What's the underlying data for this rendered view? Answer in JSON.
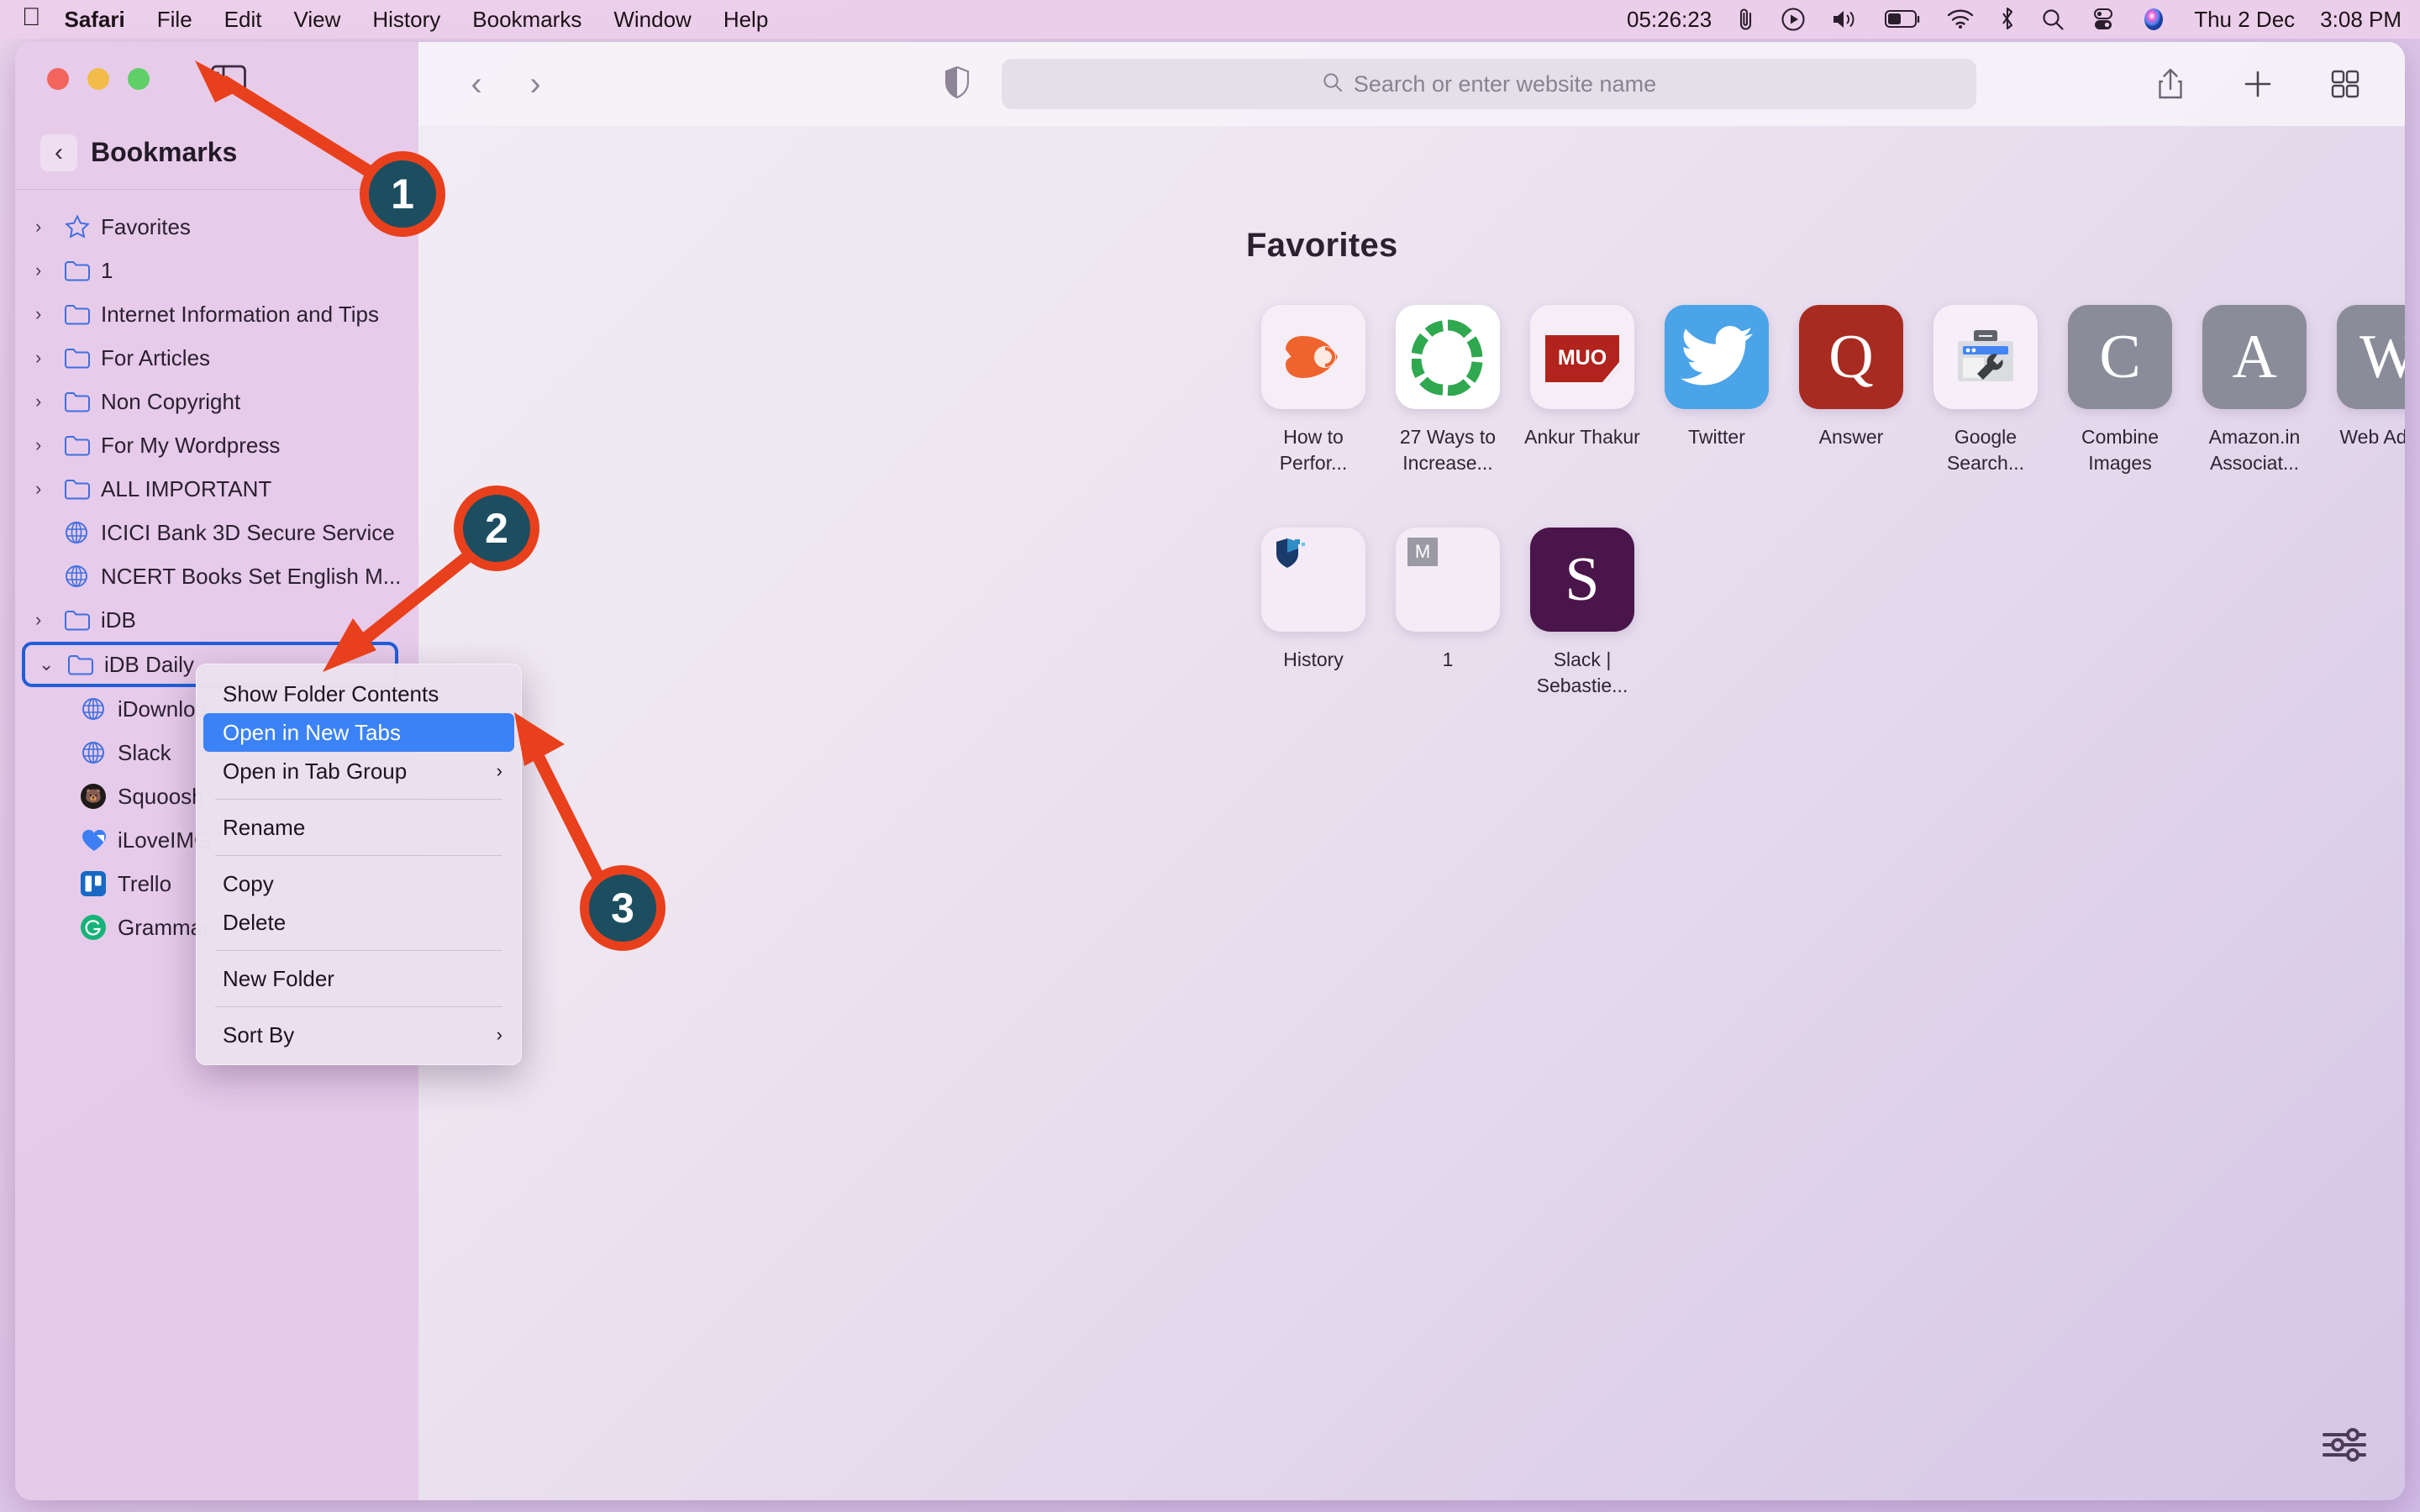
{
  "menubar": {
    "apple_icon": "apple-logo-icon",
    "items": [
      "Safari",
      "File",
      "Edit",
      "View",
      "History",
      "Bookmarks",
      "Window",
      "Help"
    ],
    "status": {
      "timer": "05:26:23",
      "paperclip_icon": "paperclip-icon",
      "play_icon": "play-circle-icon",
      "volume_icon": "volume-icon",
      "battery_icon": "battery-icon",
      "wifi_icon": "wifi-icon",
      "bluetooth_icon": "bluetooth-icon",
      "spotlight_icon": "search-icon",
      "control_center_icon": "control-center-icon",
      "siri_icon": "siri-icon",
      "date": "Thu 2 Dec",
      "time": "3:08 PM"
    }
  },
  "window_controls": {
    "close": "close-button",
    "minimize": "minimize-button",
    "zoom": "zoom-button",
    "sidebar_toggle": "sidebar-toggle-button",
    "tab_overview": "new-tab-group-button"
  },
  "sidebar": {
    "back_glyph": "‹",
    "title": "Bookmarks",
    "items": [
      {
        "label": "Favorites",
        "icon": "star-icon",
        "twisty": "›",
        "level": 0
      },
      {
        "label": "1",
        "icon": "folder-icon",
        "twisty": "›",
        "level": 0
      },
      {
        "label": "Internet Information and Tips",
        "icon": "folder-icon",
        "twisty": "›",
        "level": 0
      },
      {
        "label": "For Articles",
        "icon": "folder-icon",
        "twisty": "›",
        "level": 0
      },
      {
        "label": "Non Copyright",
        "icon": "folder-icon",
        "twisty": "›",
        "level": 0
      },
      {
        "label": "For My Wordpress",
        "icon": "folder-icon",
        "twisty": "›",
        "level": 0
      },
      {
        "label": "ALL IMPORTANT",
        "icon": "folder-icon",
        "twisty": "›",
        "level": 0
      },
      {
        "label": "ICICI Bank 3D Secure Service",
        "icon": "globe-icon",
        "twisty": "",
        "level": 1
      },
      {
        "label": "NCERT Books Set English M...",
        "icon": "globe-icon",
        "twisty": "",
        "level": 1
      },
      {
        "label": "iDB",
        "icon": "folder-icon",
        "twisty": "›",
        "level": 0
      },
      {
        "label": "iDB Daily",
        "icon": "folder-icon",
        "twisty": "⌄",
        "level": 0,
        "selected": true
      },
      {
        "label": "iDownloa",
        "icon": "globe-icon",
        "twisty": "",
        "level": 2
      },
      {
        "label": "Slack",
        "icon": "globe-icon",
        "twisty": "",
        "level": 2
      },
      {
        "label": "Squoosh",
        "icon": "squoosh-icon",
        "twisty": "",
        "level": 2
      },
      {
        "label": "iLoveIMG",
        "icon": "iloveimg-icon",
        "twisty": "",
        "level": 2
      },
      {
        "label": "Trello",
        "icon": "trello-icon",
        "twisty": "",
        "level": 2
      },
      {
        "label": "Grammar",
        "icon": "grammarly-icon",
        "twisty": "",
        "level": 2
      }
    ]
  },
  "toolbar": {
    "back_glyph": "‹",
    "forward_glyph": "›",
    "shield_icon": "privacy-shield-icon",
    "search_placeholder": "Search or enter website name",
    "search_icon": "search-icon",
    "share_icon": "share-icon",
    "new_tab_icon": "plus-icon",
    "tab_overview_icon": "tab-overview-icon"
  },
  "main": {
    "favorites_title": "Favorites",
    "favorites": [
      {
        "label": "How to Perfor...",
        "icon": "semrush-icon",
        "bg": "#f6eef7",
        "letter": ""
      },
      {
        "label": "27 Ways to Increase...",
        "icon": "donut-chart-icon",
        "bg": "#ffffff",
        "letter": ""
      },
      {
        "label": "Ankur Thakur",
        "icon": "muo-icon",
        "bg": "#f6eef7",
        "letter": ""
      },
      {
        "label": "Twitter",
        "icon": "twitter-icon",
        "bg": "#4ba3e8",
        "letter": ""
      },
      {
        "label": "Answer",
        "icon": "quora-icon",
        "bg": "#a82b21",
        "letter": "Q"
      },
      {
        "label": "Google Search...",
        "icon": "google-search-console-icon",
        "bg": "#f7eff8",
        "letter": ""
      },
      {
        "label": "Combine Images",
        "icon": "letter-tile-icon",
        "bg": "#8b8c99",
        "letter": "C"
      },
      {
        "label": "Amazon.in Associat...",
        "icon": "letter-tile-icon",
        "bg": "#8b8c99",
        "letter": "A"
      },
      {
        "label": "Web Admin",
        "icon": "letter-tile-icon",
        "bg": "#8b8c99",
        "letter": "W"
      },
      {
        "label": "History",
        "icon": "shield-favicon-icon",
        "bg": "#f4ebf6",
        "letter": ""
      },
      {
        "label": "1",
        "icon": "m-badge-icon",
        "bg": "#f4ebf6",
        "letter": ""
      },
      {
        "label": "Slack | Sebastie...",
        "icon": "slack-s-icon",
        "bg": "#4a154b",
        "letter": "S"
      }
    ]
  },
  "context_menu": {
    "items": [
      {
        "label": "Show Folder Contents",
        "submenu": false,
        "active": false
      },
      {
        "label": "Open in New Tabs",
        "submenu": false,
        "active": true
      },
      {
        "label": "Open in Tab Group",
        "submenu": true,
        "active": false
      },
      {
        "sep": true
      },
      {
        "label": "Rename",
        "submenu": false,
        "active": false
      },
      {
        "sep": true
      },
      {
        "label": "Copy",
        "submenu": false,
        "active": false
      },
      {
        "label": "Delete",
        "submenu": false,
        "active": false
      },
      {
        "sep": true
      },
      {
        "label": "New Folder",
        "submenu": false,
        "active": false
      },
      {
        "sep": true
      },
      {
        "label": "Sort By",
        "submenu": true,
        "active": false
      }
    ],
    "submenu_arrow": "›"
  },
  "callouts": [
    {
      "number": "1"
    },
    {
      "number": "2"
    },
    {
      "number": "3"
    }
  ],
  "colors": {
    "callout_ring": "#e8401c",
    "callout_fill": "#1c4e60",
    "menu_highlight": "#3b82f6",
    "selection_border": "#1f5fd8",
    "folder_icon": "#3f6fe0"
  },
  "footer": {
    "settings_icon": "sliders-icon"
  }
}
